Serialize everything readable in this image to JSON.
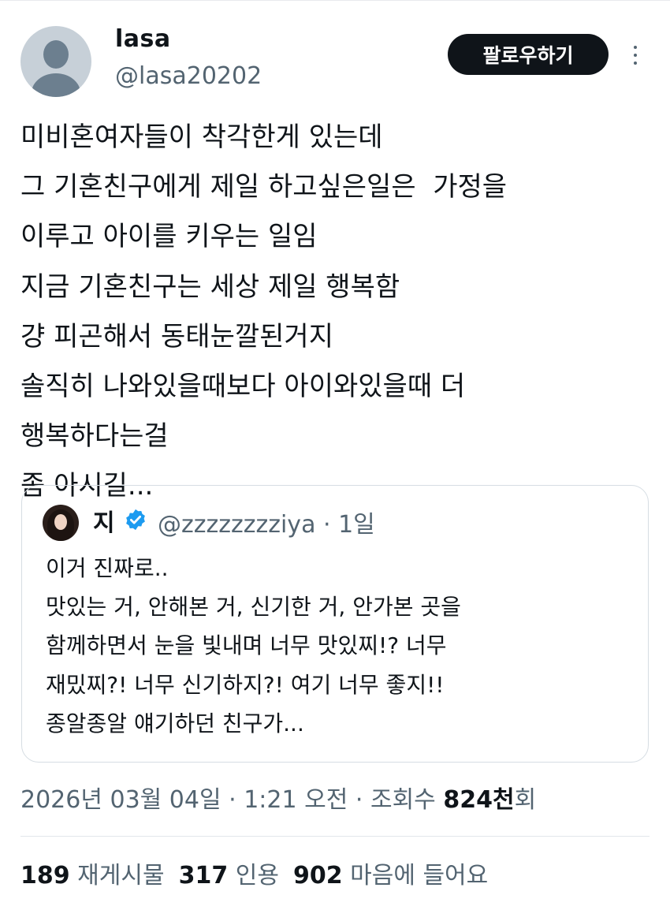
{
  "author": {
    "display_name": "lasa",
    "handle": "@lasa20202"
  },
  "follow_label": "팔로우하기",
  "tweet_lines": [
    "미비혼여자들이 착각한게 있는데",
    "그 기혼친구에게 제일 하고싶은일은  가정을",
    "이루고 아이를 키우는 일임",
    "지금 기혼친구는 세상 제일 행복함",
    "걍 피곤해서 동태눈깔된거지",
    "솔직히 나와있을때보다 아이와있을때 더",
    "행복하다는걸",
    "좀 아시길..."
  ],
  "quote": {
    "name": "지",
    "handle": "@zzzzzzzziya",
    "separator": "·",
    "time": "1일",
    "lines": [
      "이거 진짜로..",
      "맛있는 거, 안해본 거, 신기한 거, 안가본 곳을",
      "함께하면서 눈을 빛내며 너무 맛있찌!? 너무",
      "재밌찌?! 너무 신기하지?! 여기 너무 좋지!!",
      "종알종알 얘기하던 친구가..."
    ]
  },
  "meta": {
    "date": "2026년 03월 04일",
    "sep1": "·",
    "time": "1:21 오전",
    "sep2": "·",
    "views_label": "조회수",
    "views_value": "824천",
    "views_suffix": "회"
  },
  "stats": {
    "reposts_num": "189",
    "reposts_label": "재게시물",
    "quotes_num": "317",
    "quotes_label": "인용",
    "likes_num": "902",
    "likes_label": "마음에 들어요"
  },
  "colors": {
    "text": "#0f1419",
    "secondary": "#536471",
    "verified": "#1d9bf0",
    "button_bg": "#0f1419"
  },
  "icons": {
    "more": "more-vertical-icon",
    "verified": "verified-badge-icon"
  }
}
